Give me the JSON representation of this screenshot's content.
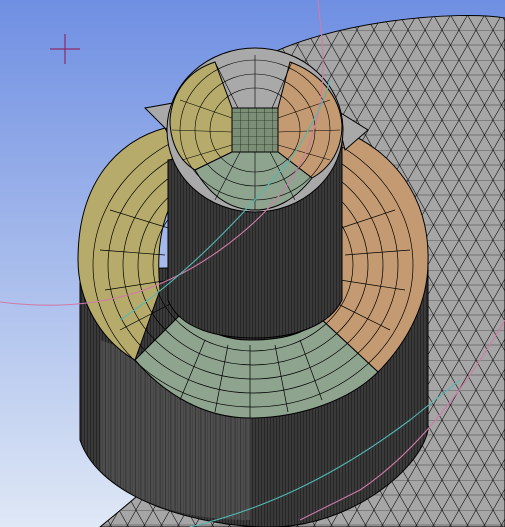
{
  "viewport": {
    "background_top": "#6f8fe2",
    "background_bottom": "#dfe8f6",
    "mesh_line_color": "#000000",
    "plate_fill": "#a6a6a6",
    "hex_core_fill": "#7b8f76",
    "sector_colors": {
      "left": "#b7ab6b",
      "bottom": "#8ea48f",
      "right": "#c39a72",
      "top": "#a9a9a9"
    },
    "guide_curve_colors": [
      "#d07aa6",
      "#52b8b4"
    ]
  },
  "icons": {
    "origin_triad": "crosshair-icon"
  }
}
